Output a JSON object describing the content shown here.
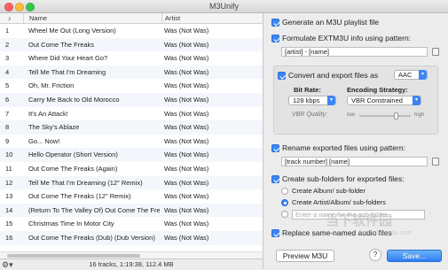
{
  "window": {
    "title": "M3Unify"
  },
  "table": {
    "headers": {
      "num": "♪",
      "name": "Name",
      "artist": "Artist"
    },
    "rows": [
      {
        "num": "1",
        "name": "Wheel Me Out (Long Version)",
        "artist": "Was (Not Was)"
      },
      {
        "num": "2",
        "name": "Out Come The Freaks",
        "artist": "Was (Not Was)"
      },
      {
        "num": "3",
        "name": "Where Did Your Heart Go?",
        "artist": "Was (Not Was)"
      },
      {
        "num": "4",
        "name": "Tell Me That I'm Dreaming",
        "artist": "Was (Not Was)"
      },
      {
        "num": "5",
        "name": "Oh, Mr. Friction",
        "artist": "Was (Not Was)"
      },
      {
        "num": "6",
        "name": "Carry Me Back to Old Morocco",
        "artist": "Was (Not Was)"
      },
      {
        "num": "7",
        "name": "It's An Attack!",
        "artist": "Was (Not Was)"
      },
      {
        "num": "8",
        "name": "The Sky's Ablaze",
        "artist": "Was (Not Was)"
      },
      {
        "num": "9",
        "name": "Go... Now!",
        "artist": "Was (Not Was)"
      },
      {
        "num": "10",
        "name": "Hello Operator (Short Version)",
        "artist": "Was (Not Was)"
      },
      {
        "num": "11",
        "name": "Out Come The Freaks (Again)",
        "artist": "Was (Not Was)"
      },
      {
        "num": "12",
        "name": "Tell Me That I'm Dreaming (12\" Remix)",
        "artist": "Was (Not Was)"
      },
      {
        "num": "13",
        "name": "Out Come The Freaks (12\" Remix)",
        "artist": "Was (Not Was)"
      },
      {
        "num": "14",
        "name": "(Return To The Valley Of) Out Come The Freaks",
        "artist": "Was (Not Was)"
      },
      {
        "num": "15",
        "name": "Christmas Time In Motor City",
        "artist": "Was (Not Was)"
      },
      {
        "num": "16",
        "name": "Out Come The Freaks (Dub) (Dub Version)",
        "artist": "Was (Not Was)"
      }
    ]
  },
  "status": {
    "summary": "16 tracks, 1:19:38, 112.4 MB",
    "gear_icon": "gear-icon"
  },
  "options": {
    "generate_playlist": {
      "label": "Generate an M3U playlist file",
      "checked": true
    },
    "formulate_extm3u": {
      "label": "Formulate EXTM3U info using pattern:",
      "checked": true,
      "pattern": "[artist] - [name]"
    },
    "convert": {
      "label": "Convert and export files as",
      "checked": true,
      "format": "AAC",
      "bitrate_label": "Bit Rate:",
      "bitrate": "128 kbps",
      "encoding_label": "Encoding Strategy:",
      "encoding": "VBR Constrained",
      "vbr_label": "VBR Quality:",
      "vbr_low": "low",
      "vbr_high": "high",
      "vbr_level": 0.72
    },
    "rename": {
      "label": "Rename exported files using pattern:",
      "checked": true,
      "pattern": "[track number] [name]"
    },
    "subfolders": {
      "label": "Create sub-folders for exported files:",
      "checked": true,
      "choices": [
        "Create Album/ sub-folder",
        "Create Artist/Album/ sub-folders"
      ],
      "selected": 1,
      "custom_placeholder": "Enter a name for the sub-folder..."
    },
    "replace": {
      "label": "Replace same-named audio files",
      "checked": true
    }
  },
  "buttons": {
    "preview": "Preview M3U",
    "help": "?",
    "save": "Save..."
  },
  "watermark": {
    "text": "当下软件园",
    "url": "www.downxia.com"
  }
}
